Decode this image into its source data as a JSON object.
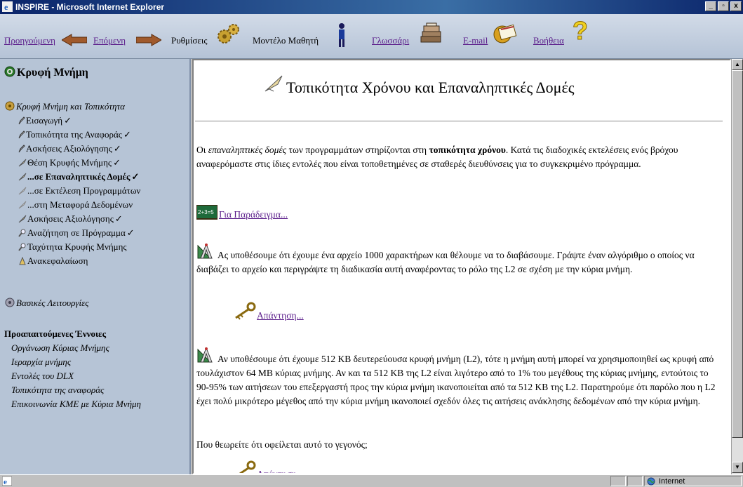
{
  "window": {
    "title": "INSPIRE - Microsoft Internet Explorer",
    "buttons": [
      "_",
      "▫",
      "x"
    ]
  },
  "nav": {
    "previous": "Προηγούμενη",
    "next": "Επόμενη",
    "settings": "Ρυθμίσεις",
    "student_model": "Μοντέλο Μαθητή",
    "glossary": "Γλωσσάρι",
    "email": "E-mail",
    "help": "Βοήθεια"
  },
  "sidebar": {
    "title": "Κρυφή Μνήμη",
    "group1": "Κρυφή Μνήμη και Τοπικότητα",
    "items": [
      {
        "label": "Εισαγωγή",
        "check": "✓"
      },
      {
        "label": "Τοπικότητα της Αναφοράς",
        "check": "✓"
      },
      {
        "label": "Ασκήσεις Αξιολόγησης",
        "check": "✓"
      },
      {
        "label": "Θέση Κρυφής Μνήμης",
        "check": "✓"
      },
      {
        "label": "...σε Επαναληπτικές Δομές",
        "check": "✓"
      },
      {
        "label": "...σε Εκτέλεση Προγραμμάτων",
        "check": ""
      },
      {
        "label": "...στη Μεταφορά Δεδομένων",
        "check": ""
      },
      {
        "label": "Ασκήσεις Αξιολόγησης",
        "check": "✓"
      },
      {
        "label": "Αναζήτηση σε Πρόγραμμα",
        "check": "✓"
      },
      {
        "label": "Ταχύτητα Κρυφής Μνήμης",
        "check": ""
      },
      {
        "label": "Ανακεφαλαίωση",
        "check": ""
      }
    ],
    "group2": "Βασικές Λειτουργίες",
    "prereq_title": "Προαπαιτούμενες Έννοιες",
    "prereqs": [
      "Οργάνωση Κύριας Μνήμης",
      "Ιεραρχία μνήμης",
      "Εντολές του DLX",
      "Τοπικότητα της αναφοράς",
      "Επικοινωνία ΚΜΕ με Κύρια Μνήμη"
    ]
  },
  "main": {
    "title": "Τοπικότητα Χρόνου και Επαναληπτικές Δομές",
    "intro": {
      "p1": "Οι ",
      "em": "επαναληπτικές δομές",
      "p2": " των προγραμμάτων στηρίζονται στη ",
      "strong": "τοπικότητα χρόνου",
      "p3": ". Κατά τις διαδοχικές εκτελέσεις ενός βρόχου αναφερόμαστε στις ίδιες εντολές που είναι τοποθετημένες σε σταθερές διευθύνσεις για το συγκεκριμένο πρόγραμμα."
    },
    "example_icon_text": "2+3=5",
    "example_link": "Για Παράδειγμα...",
    "exercise1": "Ας υποθέσουμε ότι έχουμε ένα αρχείο 1000 χαρακτήρων και θέλουμε να το διαβάσουμε. Γράψτε έναν αλγόριθμο ο οποίος να διαβάζει το αρχείο και περιγράψτε τη διαδικασία αυτή αναφέροντας το ρόλο της L2 σε σχέση με την κύρια μνήμη.",
    "answer_link": "Απάντηση...",
    "exercise2": "Αν υποθέσουμε ότι έχουμε 512 KB δευτερεύουσα κρυφή μνήμη (L2), τότε η μνήμη αυτή μπορεί να χρησιμοποιηθεί ως κρυφή από τουλάχιστον 64 MB κύριας μνήμης. Αν και τα 512 KB της L2 είναι λιγότερο από το 1% του μεγέθους της κύριας μνήμης, εντούτοις το 90-95% των αιτήσεων του επεξεργαστή προς την κύρια μνήμη ικανοποιείται από τα 512 KB της L2. Παρατηρούμε ότι παρόλο που η L2 έχει πολύ μικρότερο μέγεθος από την κύρια μνήμη ικανοποιεί σχεδόν όλες τις αιτήσεις ανάκλησης δεδομένων από την κύρια μνήμη.",
    "question": "Που θεωρείτε ότι οφείλεται αυτό το γεγονός;",
    "answer_link2": "Απάντηση..."
  },
  "status": {
    "zone": "Internet"
  }
}
